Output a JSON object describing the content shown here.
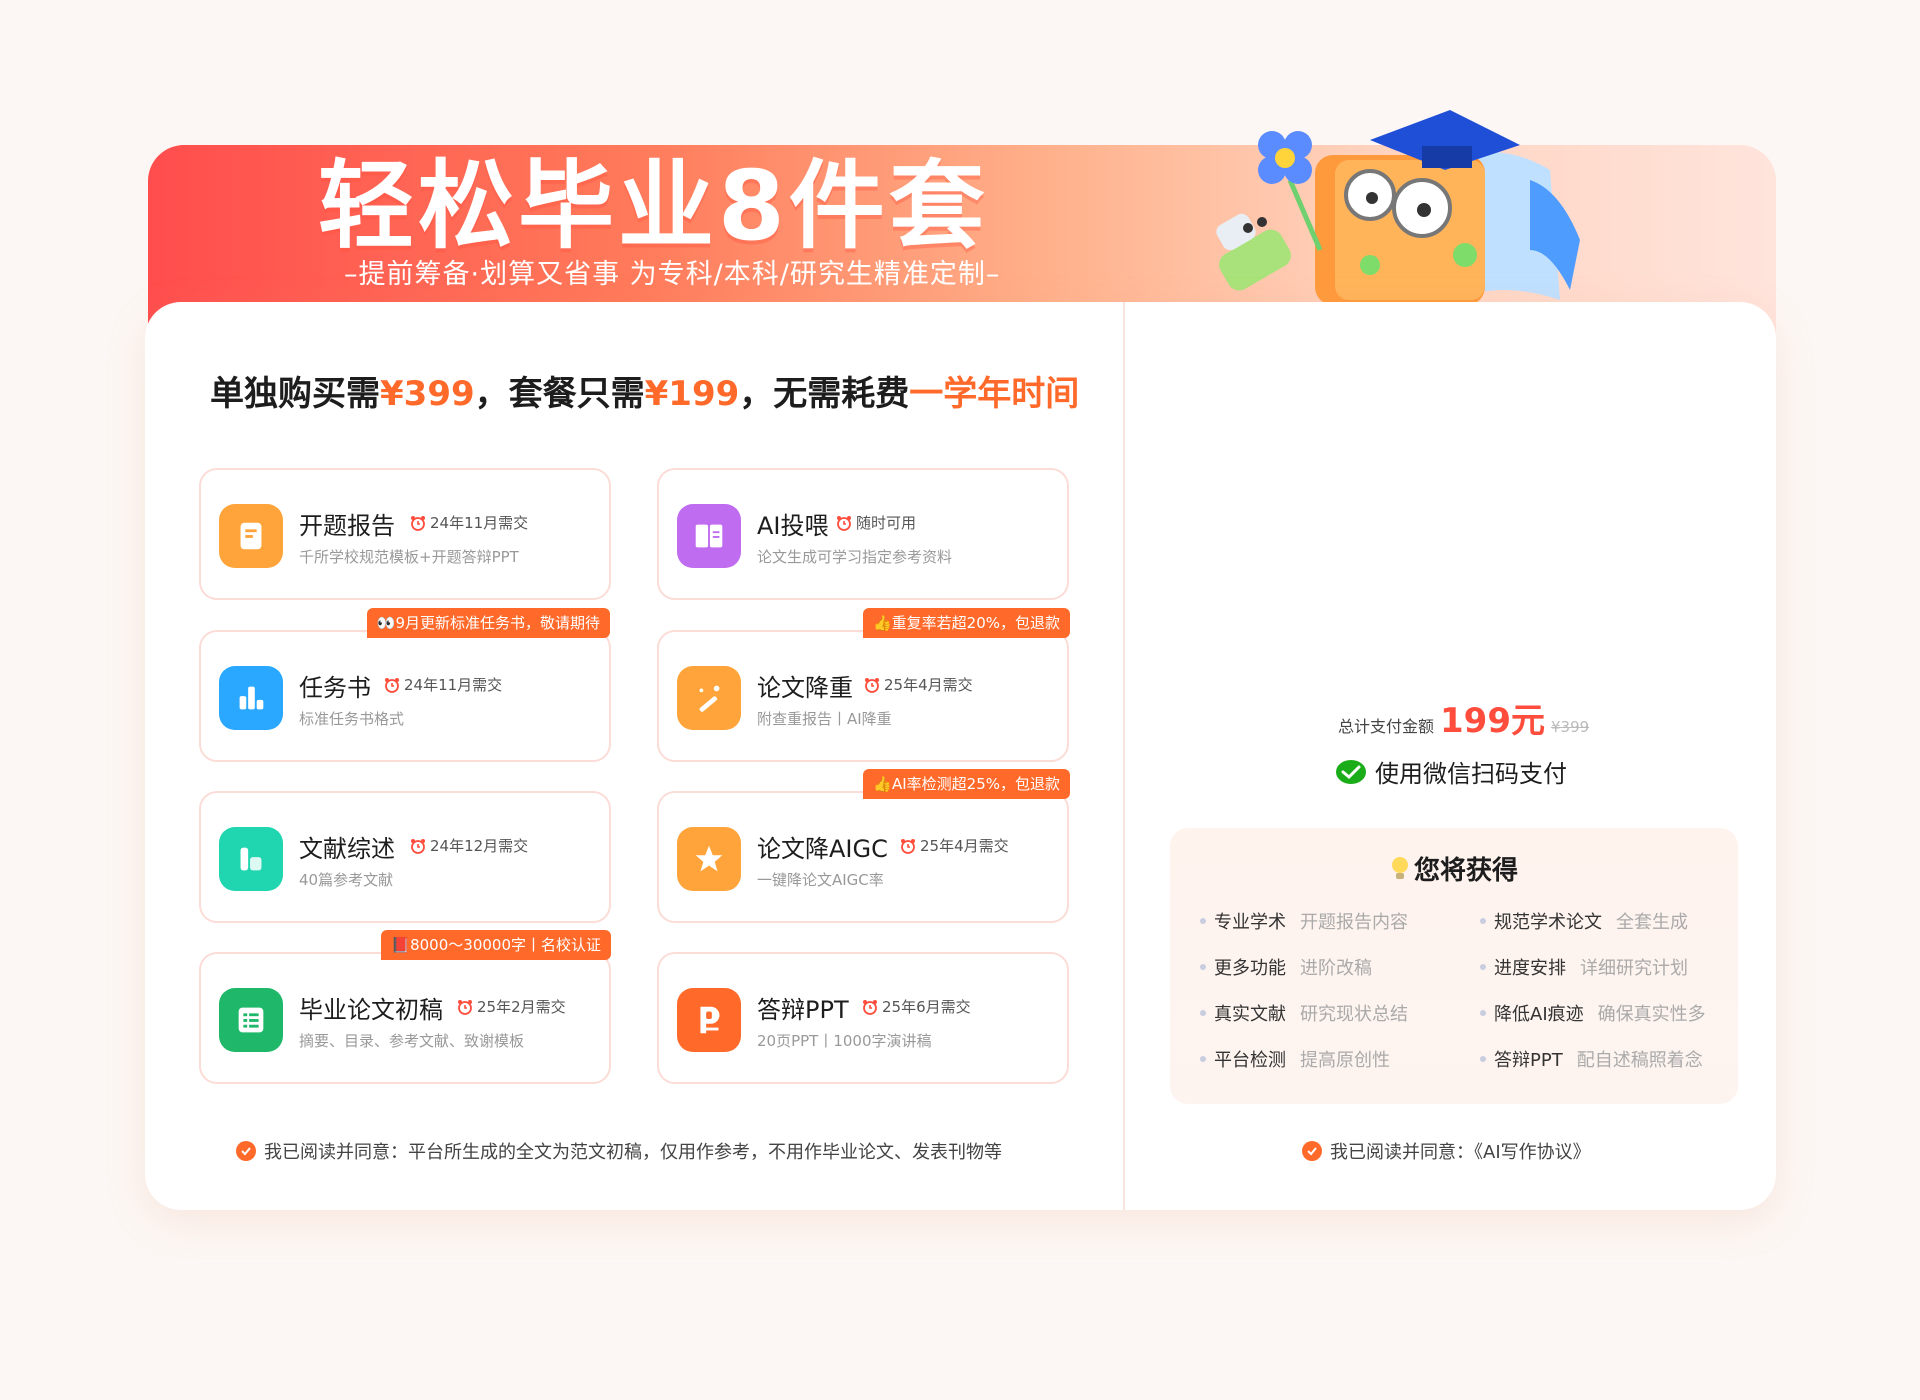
{
  "banner": {
    "title": "轻松毕业8件套",
    "subtitle": "–提前筹备·划算又省事 为专科/本科/研究生精准定制–"
  },
  "headline": {
    "part1": "单独购买需",
    "price1": "¥399",
    "part2": "，套餐只需",
    "price2": "¥199",
    "part3": "，无需耗费",
    "highlight": "一学年时间"
  },
  "features": [
    {
      "title": "开题报告",
      "due": "24年11月需交",
      "desc": "千所学校规范模板+开题答辩PPT",
      "icon": "scroll-icon",
      "color": "#ffa43a"
    },
    {
      "title": "AI投喂",
      "due": "随时可用",
      "desc": "论文生成可学习指定参考资料",
      "icon": "book-icon",
      "color": "#c06cf0"
    },
    {
      "title": "任务书",
      "due": "24年11月需交",
      "desc": "标准任务书格式",
      "icon": "bar-chart-icon",
      "color": "#2aa8ff",
      "badge": "👀9月更新标准任务书，敬请期待"
    },
    {
      "title": "论文降重",
      "due": "25年4月需交",
      "desc": "附查重报告丨AI降重",
      "icon": "magic-wand-icon",
      "color": "#ffa43a",
      "badge": "👍重复率若超20%，包退款"
    },
    {
      "title": "文献综述",
      "due": "24年12月需交",
      "desc": "40篇参考文献",
      "icon": "layers-icon",
      "color": "#1fd6b0"
    },
    {
      "title": "论文降AIGC",
      "due": "25年4月需交",
      "desc": "一键降论文AIGC率",
      "icon": "star-icon",
      "color": "#ffa43a",
      "badge": "👍AI率检测超25%，包退款"
    },
    {
      "title": "毕业论文初稿",
      "due": "25年2月需交",
      "desc": "摘要、目录、参考文献、致谢模板",
      "icon": "document-list-icon",
      "color": "#1fb86a",
      "badge": "📕8000～30000字丨名校认证"
    },
    {
      "title": "答辩PPT",
      "due": "25年6月需交",
      "desc": "20页PPT丨1000字演讲稿",
      "icon": "ppt-icon",
      "color": "#ff6a2b"
    }
  ],
  "agree_left": "我已阅读并同意：平台所生成的全文为范文初稿，仅用作参考，不用作毕业论文、发表刊物等",
  "payment": {
    "total_label": "总计支付金额",
    "price": "199元",
    "original": "¥399",
    "pay_label": "使用微信扫码支付"
  },
  "gain": {
    "title": "您将获得",
    "items": [
      {
        "main": "专业学术",
        "sub": "开题报告内容"
      },
      {
        "main": "规范学术论文",
        "sub": "全套生成"
      },
      {
        "main": "更多功能",
        "sub": "进阶改稿"
      },
      {
        "main": "进度安排",
        "sub": "详细研究计划"
      },
      {
        "main": "真实文献",
        "sub": "研究现状总结"
      },
      {
        "main": "降低AI痕迹",
        "sub": "确保真实性多"
      },
      {
        "main": "平台检测",
        "sub": "提高原创性"
      },
      {
        "main": "答辩PPT",
        "sub": "配自述稿照着念"
      }
    ]
  },
  "agree_right": "我已阅读并同意：《AI写作协议》",
  "colors": {
    "accent": "#ff6a2b",
    "price": "#ff4d3d",
    "wechat": "#1aad19"
  }
}
